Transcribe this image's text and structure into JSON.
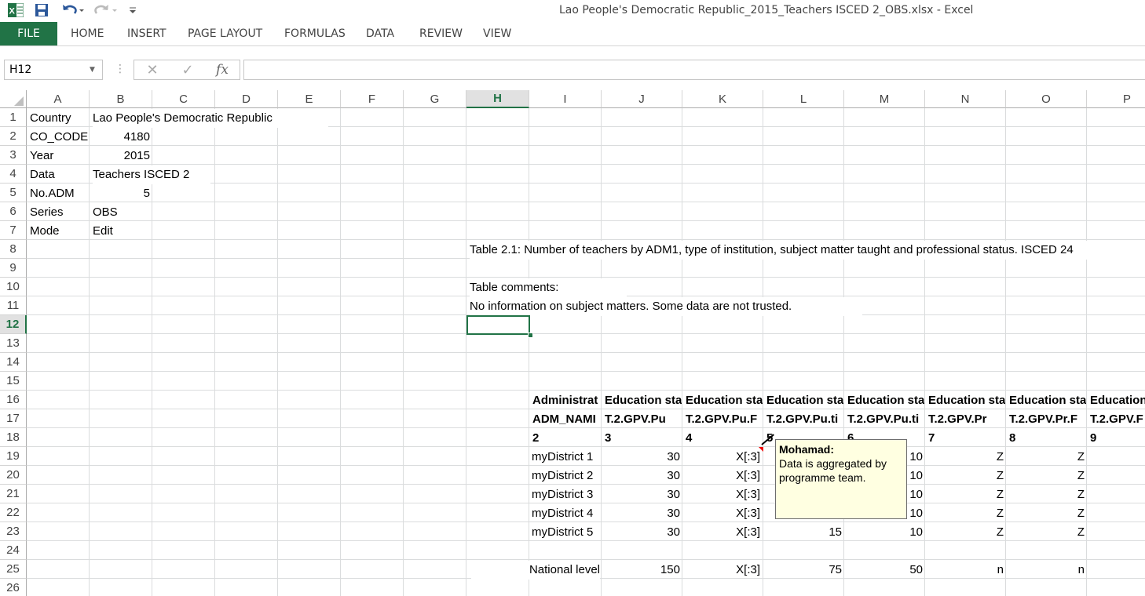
{
  "window": {
    "title": "Lao People's Democratic Republic_2015_Teachers ISCED 2_OBS.xlsx - Excel"
  },
  "quick_access": {
    "excel_icon": "excel-icon",
    "save_icon": "save-icon",
    "undo_icon": "undo-icon",
    "redo_icon": "redo-icon",
    "customize_icon": "customize-icon"
  },
  "ribbon": {
    "file": "FILE",
    "tabs": [
      "HOME",
      "INSERT",
      "PAGE LAYOUT",
      "FORMULAS",
      "DATA",
      "REVIEW",
      "VIEW"
    ]
  },
  "formula_bar": {
    "name_box": "H12",
    "cancel": "✕",
    "enter": "✓",
    "fx": "fx",
    "formula": ""
  },
  "columns": [
    "A",
    "B",
    "C",
    "D",
    "E",
    "F",
    "G",
    "H",
    "I",
    "J",
    "K",
    "L",
    "M",
    "N",
    "O",
    "P"
  ],
  "selected_column": "H",
  "rows": [
    "1",
    "2",
    "3",
    "4",
    "5",
    "6",
    "7",
    "8",
    "9",
    "10",
    "11",
    "12",
    "13",
    "14",
    "15",
    "16",
    "17",
    "18",
    "19",
    "20",
    "21",
    "22",
    "23",
    "24",
    "25",
    "26"
  ],
  "selected_row": "12",
  "meta": {
    "a1": "Country",
    "b1": "Lao People's Democratic Republic",
    "a2": "CO_CODE",
    "b2": "4180",
    "a3": "Year",
    "b3": "2015",
    "a4": "Data",
    "b4": "Teachers ISCED 2",
    "a5": "No.ADM",
    "b5": "5",
    "a6": "Series",
    "b6": "OBS",
    "a7": "Mode",
    "b7": "Edit"
  },
  "table": {
    "title": "Table 2.1: Number of teachers by ADM1, type of institution, subject matter taught and professional status. ISCED 24",
    "comments_label": "Table comments:",
    "comments": "No information on subject matters. Some data are not trusted.",
    "header16": [
      "Administrat",
      "Education sta",
      "Education sta",
      "Education sta",
      "Education sta",
      "Education sta",
      "Education sta",
      "Education"
    ],
    "header17": [
      "ADM_NAMI",
      "T.2.GPV.Pu",
      "T.2.GPV.Pu.F",
      "T.2.GPV.Pu.ti",
      "T.2.GPV.Pu.ti",
      "T.2.GPV.Pr",
      "T.2.GPV.Pr.F",
      "T.2.GPV.F"
    ],
    "header18": [
      "2",
      "3",
      "4",
      "5",
      "6",
      "7",
      "8",
      "9"
    ],
    "rows": [
      {
        "name": "myDistrict 1",
        "j": "30",
        "k": "X[:3]",
        "l": "",
        "m": "10",
        "n": "Z",
        "o": "Z"
      },
      {
        "name": "myDistrict 2",
        "j": "30",
        "k": "X[:3]",
        "l": "",
        "m": "10",
        "n": "Z",
        "o": "Z"
      },
      {
        "name": "myDistrict 3",
        "j": "30",
        "k": "X[:3]",
        "l": "",
        "m": "10",
        "n": "Z",
        "o": "Z"
      },
      {
        "name": "myDistrict 4",
        "j": "30",
        "k": "X[:3]",
        "l": "",
        "m": "10",
        "n": "Z",
        "o": "Z"
      },
      {
        "name": "myDistrict 5",
        "j": "30",
        "k": "X[:3]",
        "l": "15",
        "m": "10",
        "n": "Z",
        "o": "Z"
      }
    ],
    "national": {
      "name": "National level",
      "j": "150",
      "k": "X[:3]",
      "l": "75",
      "m": "50",
      "n": "n",
      "o": "n"
    }
  },
  "comment": {
    "author": "Mohamad:",
    "text": "Data is aggregated by programme team."
  }
}
